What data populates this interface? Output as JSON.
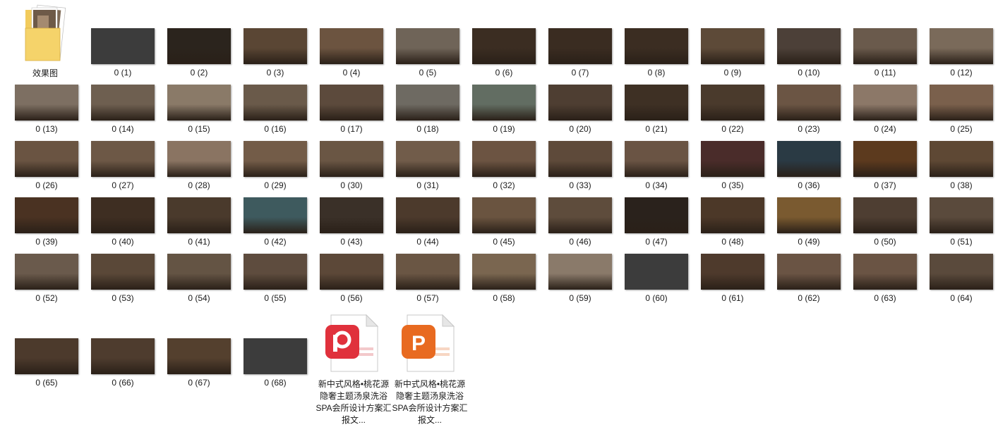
{
  "folder": {
    "name": "效果图"
  },
  "files": [
    {
      "name": "0 (1)",
      "tone": "#3a3a3a"
    },
    {
      "name": "0 (2)",
      "tone": "#2b241d"
    },
    {
      "name": "0 (3)",
      "tone": "#5a4634"
    },
    {
      "name": "0 (4)",
      "tone": "#6c5440"
    },
    {
      "name": "0 (5)",
      "tone": "#6f6458"
    },
    {
      "name": "0 (6)",
      "tone": "#3b2d22"
    },
    {
      "name": "0 (7)",
      "tone": "#3a2c21"
    },
    {
      "name": "0 (8)",
      "tone": "#3b2d22"
    },
    {
      "name": "0 (9)",
      "tone": "#5d4a38"
    },
    {
      "name": "0 (10)",
      "tone": "#4c4038"
    },
    {
      "name": "0 (11)",
      "tone": "#6a5a4c"
    },
    {
      "name": "0 (12)",
      "tone": "#7a6a5a"
    },
    {
      "name": "0 (13)",
      "tone": "#7d6f62"
    },
    {
      "name": "0 (14)",
      "tone": "#6e5f50"
    },
    {
      "name": "0 (15)",
      "tone": "#8a7a68"
    },
    {
      "name": "0 (16)",
      "tone": "#6a5a4a"
    },
    {
      "name": "0 (17)",
      "tone": "#5c4a3c"
    },
    {
      "name": "0 (18)",
      "tone": "#6e6a62"
    },
    {
      "name": "0 (19)",
      "tone": "#626d62"
    },
    {
      "name": "0 (20)",
      "tone": "#4e3e32"
    },
    {
      "name": "0 (21)",
      "tone": "#3e3024"
    },
    {
      "name": "0 (22)",
      "tone": "#4a3a2c"
    },
    {
      "name": "0 (23)",
      "tone": "#6b5544"
    },
    {
      "name": "0 (24)",
      "tone": "#8c7868"
    },
    {
      "name": "0 (25)",
      "tone": "#7a604c"
    },
    {
      "name": "0 (26)",
      "tone": "#6a5442"
    },
    {
      "name": "0 (27)",
      "tone": "#6d5846"
    },
    {
      "name": "0 (28)",
      "tone": "#8a7462"
    },
    {
      "name": "0 (29)",
      "tone": "#735c48"
    },
    {
      "name": "0 (30)",
      "tone": "#6a5644"
    },
    {
      "name": "0 (31)",
      "tone": "#715c4a"
    },
    {
      "name": "0 (32)",
      "tone": "#6c5442"
    },
    {
      "name": "0 (33)",
      "tone": "#5e4a3a"
    },
    {
      "name": "0 (34)",
      "tone": "#6a5444"
    },
    {
      "name": "0 (35)",
      "tone": "#4a2c2a"
    },
    {
      "name": "0 (36)",
      "tone": "#2a3a44"
    },
    {
      "name": "0 (37)",
      "tone": "#5c3a1e"
    },
    {
      "name": "0 (38)",
      "tone": "#5e4834"
    },
    {
      "name": "0 (39)",
      "tone": "#4a3222"
    },
    {
      "name": "0 (40)",
      "tone": "#3e2e22"
    },
    {
      "name": "0 (41)",
      "tone": "#4a3a2c"
    },
    {
      "name": "0 (42)",
      "tone": "#3e5a5e"
    },
    {
      "name": "0 (43)",
      "tone": "#3a3028"
    },
    {
      "name": "0 (44)",
      "tone": "#4c3a2c"
    },
    {
      "name": "0 (45)",
      "tone": "#6a5440"
    },
    {
      "name": "0 (46)",
      "tone": "#5e4c3c"
    },
    {
      "name": "0 (47)",
      "tone": "#2a221c"
    },
    {
      "name": "0 (48)",
      "tone": "#4c3828"
    },
    {
      "name": "0 (49)",
      "tone": "#7a5a30"
    },
    {
      "name": "0 (50)",
      "tone": "#4e3e32"
    },
    {
      "name": "0 (51)",
      "tone": "#5a4a3c"
    },
    {
      "name": "0 (52)",
      "tone": "#6a5a4c"
    },
    {
      "name": "0 (53)",
      "tone": "#5a4838"
    },
    {
      "name": "0 (54)",
      "tone": "#645444"
    },
    {
      "name": "0 (55)",
      "tone": "#5e4c3e"
    },
    {
      "name": "0 (56)",
      "tone": "#5c4838"
    },
    {
      "name": "0 (57)",
      "tone": "#6a5644"
    },
    {
      "name": "0 (58)",
      "tone": "#7a6650"
    },
    {
      "name": "0 (59)",
      "tone": "#8a7a6a"
    },
    {
      "name": "0 (60)",
      "tone": "#3a3a3a"
    },
    {
      "name": "0 (61)",
      "tone": "#4e3a2c"
    },
    {
      "name": "0 (62)",
      "tone": "#6a5444"
    },
    {
      "name": "0 (63)",
      "tone": "#6a5444"
    },
    {
      "name": "0 (64)",
      "tone": "#5a4a3c"
    },
    {
      "name": "0 (65)",
      "tone": "#4c3a2c"
    },
    {
      "name": "0 (66)",
      "tone": "#4e3c2e"
    },
    {
      "name": "0 (67)",
      "tone": "#54402e"
    },
    {
      "name": "0 (68)",
      "tone": "#3a3a3a"
    }
  ],
  "documents": [
    {
      "name": "新中式风格•桃花源隐奢主题汤泉洗浴SPA会所设计方案汇报文...",
      "type": "wps-presentation-icon",
      "color": "#e0313c"
    },
    {
      "name": "新中式风格•桃花源隐奢主题汤泉洗浴SPA会所设计方案汇报文...",
      "type": "powerpoint-icon",
      "color": "#e86a20"
    }
  ]
}
